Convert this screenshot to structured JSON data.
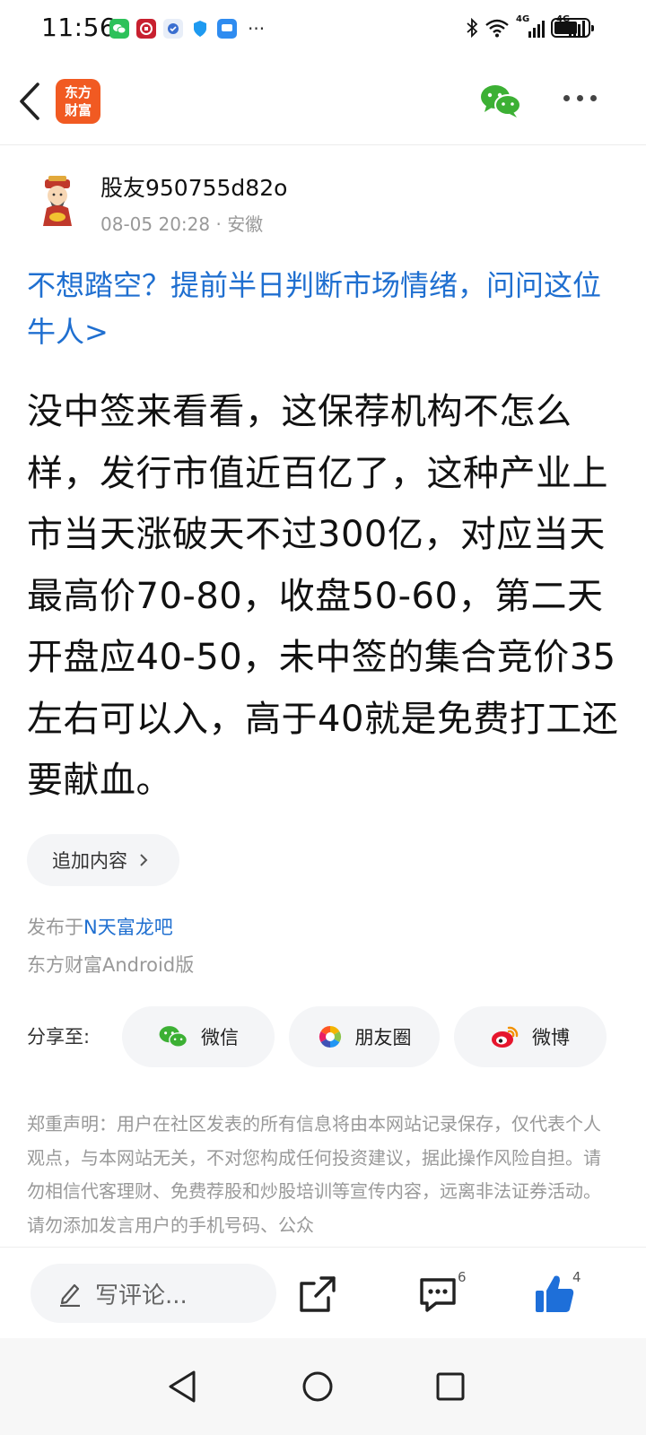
{
  "status": {
    "time": "11:56",
    "network_type": "4G",
    "battery_level": 0.7
  },
  "header": {
    "logo_text_line1": "东方",
    "logo_text_line2": "财富",
    "wechat_icon": "wechat-icon",
    "more_icon": "more-icon"
  },
  "post": {
    "author": "股友950755d82o",
    "time": "08-05 20:28",
    "location": "安徽",
    "promo": "不想踏空？提前半日判断市场情绪，问问这位牛人>",
    "body": "没中签来看看，这保荐机构不怎么样，发行市值近百亿了，这种产业上市当天涨破天不过300亿，对应当天最高价70-80，收盘50-60，第二天开盘应40-50，未中签的集合竞价35左右可以入，高于40就是免费打工还要献血。",
    "add_content": "追加内容",
    "published_prefix": "发布于",
    "bar_name": "N天富龙吧",
    "client": "东方财富Android版"
  },
  "share": {
    "label": "分享至:",
    "wechat": "微信",
    "moments": "朋友圈",
    "weibo": "微博"
  },
  "disclaimer": "郑重声明：用户在社区发表的所有信息将由本网站记录保存，仅代表个人观点，与本网站无关，不对您构成任何投资建议，据此操作风险自担。请勿相信代客理财、免费荐股和炒股培训等宣传内容，远离非法证券活动。请勿添加发言用户的手机号码、公众",
  "actions": {
    "comment_placeholder": "写评论...",
    "comment_count": "6",
    "like_count": "4"
  },
  "colors": {
    "brand": "#f15a22",
    "link": "#1f6fd0",
    "like_blue": "#1e6fd9",
    "wechat_green": "#3cb034"
  }
}
